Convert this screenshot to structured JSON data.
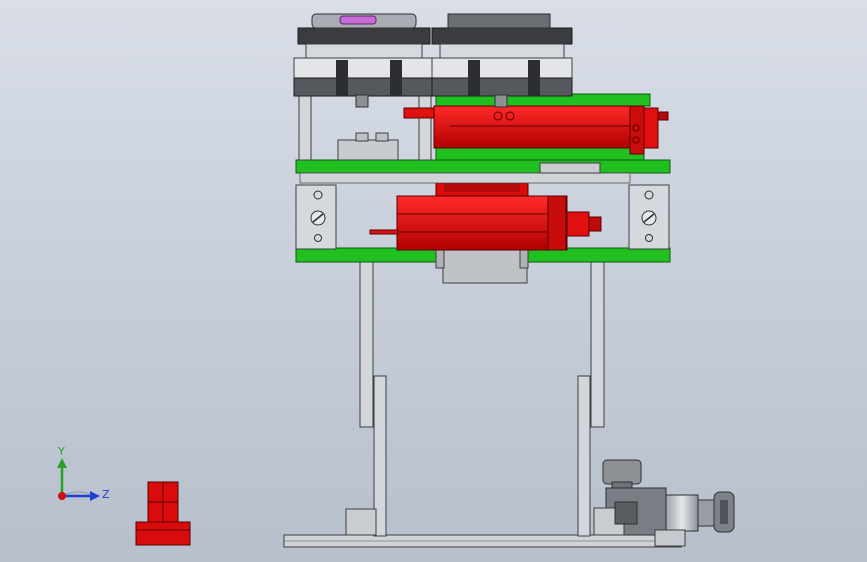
{
  "view": {
    "background_top": "#d9dee7",
    "background_bottom": "#b7bfcc"
  },
  "colors": {
    "green": "#21c021",
    "green_dark": "#0f7a0f",
    "red": "#d50c0c",
    "red_dark": "#8a0000",
    "gray": "#c8cbd0",
    "gray_dark": "#4a4c50",
    "purple": "#c76bd6"
  },
  "triad": {
    "y_label": "Y",
    "z_label": "Z",
    "y_color": "#2aa02a",
    "z_color": "#1f3fd6",
    "x_color": "#d01010"
  },
  "icons": {
    "triad": "coordinate-triad-icon",
    "view_cube": "view-cube-icon"
  }
}
